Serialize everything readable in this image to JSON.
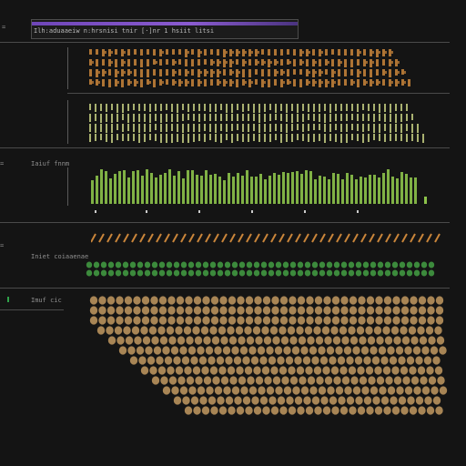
{
  "header": {
    "title_text": "Ilh:aduaaeiw n:hrsnisi tnir [·]nr 1 hsiit litsi",
    "accent_color": "#7a4fc4"
  },
  "labels": {
    "row3_label": "Iaiuf  fnnm",
    "row4_label": "Iniet coiaaenae",
    "row5_label": "Imuf cic",
    "left_marks": [
      "=",
      "=",
      "=",
      "=",
      "="
    ]
  },
  "colors": {
    "orange": "#c9853a",
    "olive": "#b9c27a",
    "green": "#8cc24a",
    "dot_green": "#3c8a3c",
    "dot_tan": "#a88555"
  }
}
